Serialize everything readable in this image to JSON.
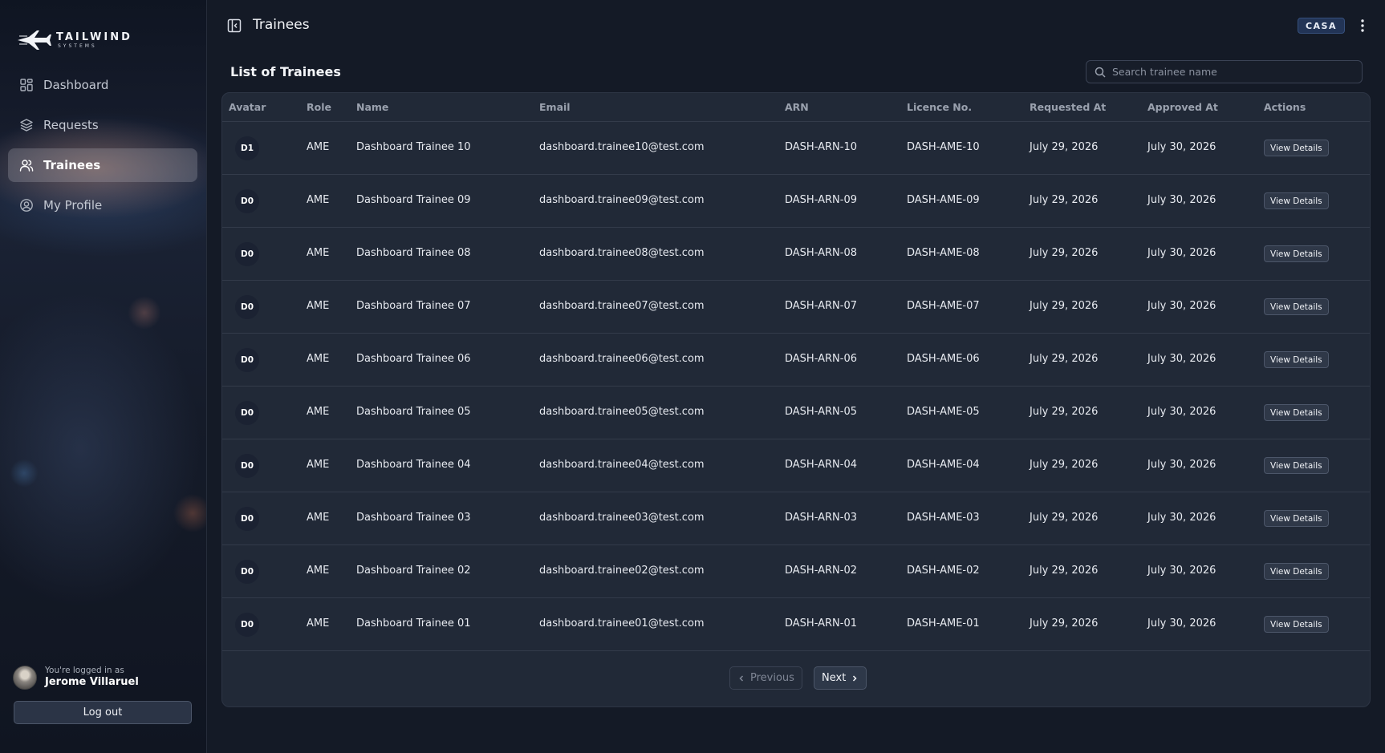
{
  "brand": {
    "name": "TAILWIND",
    "sub": "SYSTEMS"
  },
  "sidebar": {
    "items": [
      {
        "label": "Dashboard",
        "icon": "grid-icon"
      },
      {
        "label": "Requests",
        "icon": "layers-icon"
      },
      {
        "label": "Trainees",
        "icon": "users-icon",
        "active": true
      },
      {
        "label": "My Profile",
        "icon": "user-circle-icon"
      }
    ],
    "user_caption": "You're logged in as",
    "user_name": "Jerome Villaruel",
    "logout_label": "Log out"
  },
  "header": {
    "title": "Trainees",
    "org_badge": "CASA"
  },
  "main": {
    "list_title": "List of Trainees",
    "search_placeholder": "Search trainee name",
    "columns": [
      "Avatar",
      "Role",
      "Name",
      "Email",
      "ARN",
      "Licence No.",
      "Requested At",
      "Approved At",
      "Actions"
    ],
    "rows": [
      {
        "avatar": "D1",
        "role": "AME",
        "name": "Dashboard Trainee 10",
        "email": "dashboard.trainee10@test.com",
        "arn": "DASH-ARN-10",
        "licence": "DASH-AME-10",
        "requested": "July 29, 2026",
        "approved": "July 30, 2026",
        "action": "View Details"
      },
      {
        "avatar": "D0",
        "role": "AME",
        "name": "Dashboard Trainee 09",
        "email": "dashboard.trainee09@test.com",
        "arn": "DASH-ARN-09",
        "licence": "DASH-AME-09",
        "requested": "July 29, 2026",
        "approved": "July 30, 2026",
        "action": "View Details"
      },
      {
        "avatar": "D0",
        "role": "AME",
        "name": "Dashboard Trainee 08",
        "email": "dashboard.trainee08@test.com",
        "arn": "DASH-ARN-08",
        "licence": "DASH-AME-08",
        "requested": "July 29, 2026",
        "approved": "July 30, 2026",
        "action": "View Details"
      },
      {
        "avatar": "D0",
        "role": "AME",
        "name": "Dashboard Trainee 07",
        "email": "dashboard.trainee07@test.com",
        "arn": "DASH-ARN-07",
        "licence": "DASH-AME-07",
        "requested": "July 29, 2026",
        "approved": "July 30, 2026",
        "action": "View Details"
      },
      {
        "avatar": "D0",
        "role": "AME",
        "name": "Dashboard Trainee 06",
        "email": "dashboard.trainee06@test.com",
        "arn": "DASH-ARN-06",
        "licence": "DASH-AME-06",
        "requested": "July 29, 2026",
        "approved": "July 30, 2026",
        "action": "View Details"
      },
      {
        "avatar": "D0",
        "role": "AME",
        "name": "Dashboard Trainee 05",
        "email": "dashboard.trainee05@test.com",
        "arn": "DASH-ARN-05",
        "licence": "DASH-AME-05",
        "requested": "July 29, 2026",
        "approved": "July 30, 2026",
        "action": "View Details"
      },
      {
        "avatar": "D0",
        "role": "AME",
        "name": "Dashboard Trainee 04",
        "email": "dashboard.trainee04@test.com",
        "arn": "DASH-ARN-04",
        "licence": "DASH-AME-04",
        "requested": "July 29, 2026",
        "approved": "July 30, 2026",
        "action": "View Details"
      },
      {
        "avatar": "D0",
        "role": "AME",
        "name": "Dashboard Trainee 03",
        "email": "dashboard.trainee03@test.com",
        "arn": "DASH-ARN-03",
        "licence": "DASH-AME-03",
        "requested": "July 29, 2026",
        "approved": "July 30, 2026",
        "action": "View Details"
      },
      {
        "avatar": "D0",
        "role": "AME",
        "name": "Dashboard Trainee 02",
        "email": "dashboard.trainee02@test.com",
        "arn": "DASH-ARN-02",
        "licence": "DASH-AME-02",
        "requested": "July 29, 2026",
        "approved": "July 30, 2026",
        "action": "View Details"
      },
      {
        "avatar": "D0",
        "role": "AME",
        "name": "Dashboard Trainee 01",
        "email": "dashboard.trainee01@test.com",
        "arn": "DASH-ARN-01",
        "licence": "DASH-AME-01",
        "requested": "July 29, 2026",
        "approved": "July 30, 2026",
        "action": "View Details"
      }
    ]
  },
  "pagination": {
    "previous_label": "Previous",
    "next_label": "Next"
  },
  "colors": {
    "background": "#141a26",
    "card": "#212937",
    "accent_badge": "#223456"
  }
}
